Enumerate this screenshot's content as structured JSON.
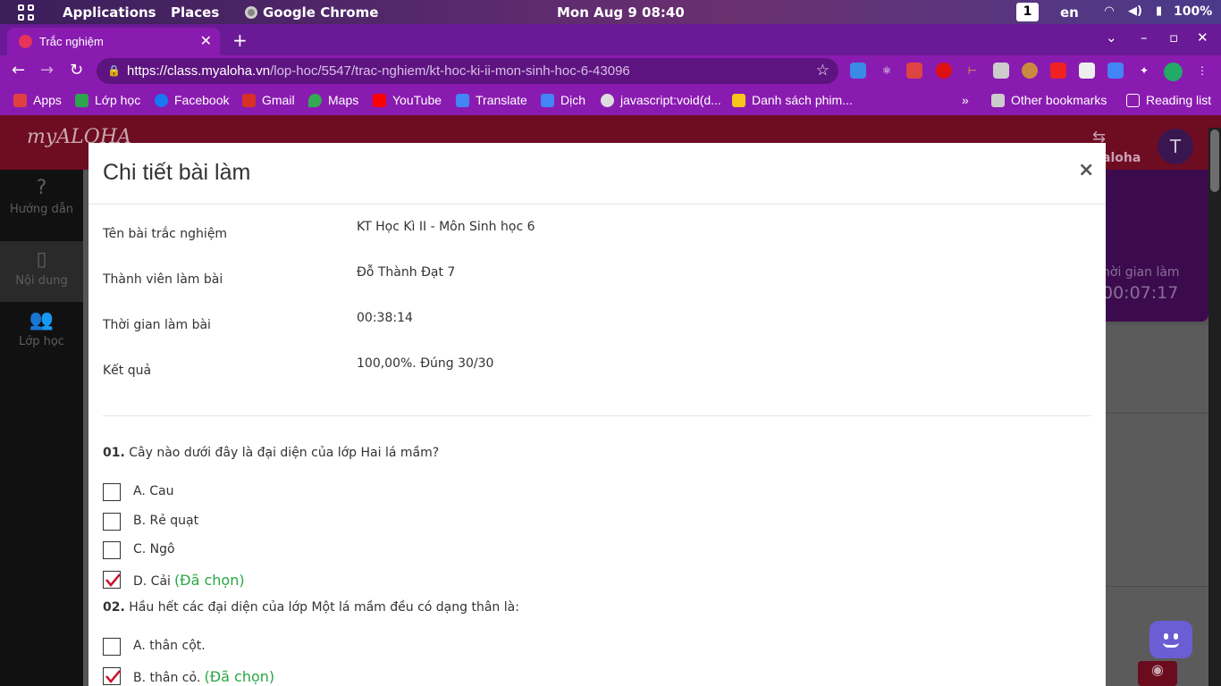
{
  "topbar": {
    "applications": "Applications",
    "places": "Places",
    "app": "Google Chrome",
    "clock": "Mon Aug 9  08:40",
    "workspace": "1",
    "lang": "en",
    "battery": "100%"
  },
  "browser": {
    "tab_title": "Trắc nghiệm",
    "url_domain": "https://class.myaloha.vn",
    "url_path": "/lop-hoc/5547/trac-nghiem/kt-hoc-ki-ii-mon-sinh-hoc-6-43096",
    "bookmarks": [
      {
        "label": "Apps",
        "color": "#e04040"
      },
      {
        "label": "Lớp học",
        "color": "#2da44e"
      },
      {
        "label": "Facebook",
        "color": "#1877f2"
      },
      {
        "label": "Gmail",
        "color": "#d93025"
      },
      {
        "label": "Maps",
        "color": "#34a853"
      },
      {
        "label": "YouTube",
        "color": "#ff0000"
      },
      {
        "label": "Translate",
        "color": "#4285f4"
      },
      {
        "label": "Dịch",
        "color": "#4285f4"
      },
      {
        "label": "javascript:void(d...",
        "color": "#dddddd"
      },
      {
        "label": "Danh sách phim...",
        "color": "#f5c518"
      }
    ],
    "other_bookmarks": "Other bookmarks",
    "reading_list": "Reading list"
  },
  "site": {
    "logo": "myALOHA",
    "avatar_letter": "T",
    "aloha_label": "aloha",
    "nav": [
      {
        "label": "Hướng dẫn",
        "icon": "?"
      },
      {
        "label": "Nội dung",
        "icon": "▯"
      },
      {
        "label": "Lớp học",
        "icon": "👥"
      }
    ],
    "timer_label": "hời gian làm",
    "timer_value": "00:07:17"
  },
  "modal": {
    "title": "Chi tiết bài làm",
    "close": "×",
    "info": [
      {
        "label": "Tên bài trắc nghiệm",
        "value": "KT Học Kì II - Môn Sinh học 6"
      },
      {
        "label": "Thành viên làm bài",
        "value": "Đỗ Thành Đạt 7"
      },
      {
        "label": "Thời gian làm bài",
        "value": "00:38:14"
      },
      {
        "label": "Kết quả",
        "value": "100,00%. Đúng 30/30"
      }
    ],
    "chosen_label": "(Đã chọn)",
    "questions": [
      {
        "num": "01.",
        "text": "Cây nào dưới đây là đại diện của lớp Hai lá mầm?",
        "options": [
          {
            "text": "A. Cau",
            "checked": false
          },
          {
            "text": "B. Rẻ quạt",
            "checked": false
          },
          {
            "text": "C. Ngô",
            "checked": false
          },
          {
            "text": "D. Cải",
            "checked": true
          }
        ]
      },
      {
        "num": "02.",
        "text": "Hầu hết các đại diện của lớp Một lá mầm đều có dạng thân là:",
        "options": [
          {
            "text": "A. thân cột.",
            "checked": false
          },
          {
            "text": "B. thân cỏ.",
            "checked": true
          }
        ]
      }
    ]
  }
}
